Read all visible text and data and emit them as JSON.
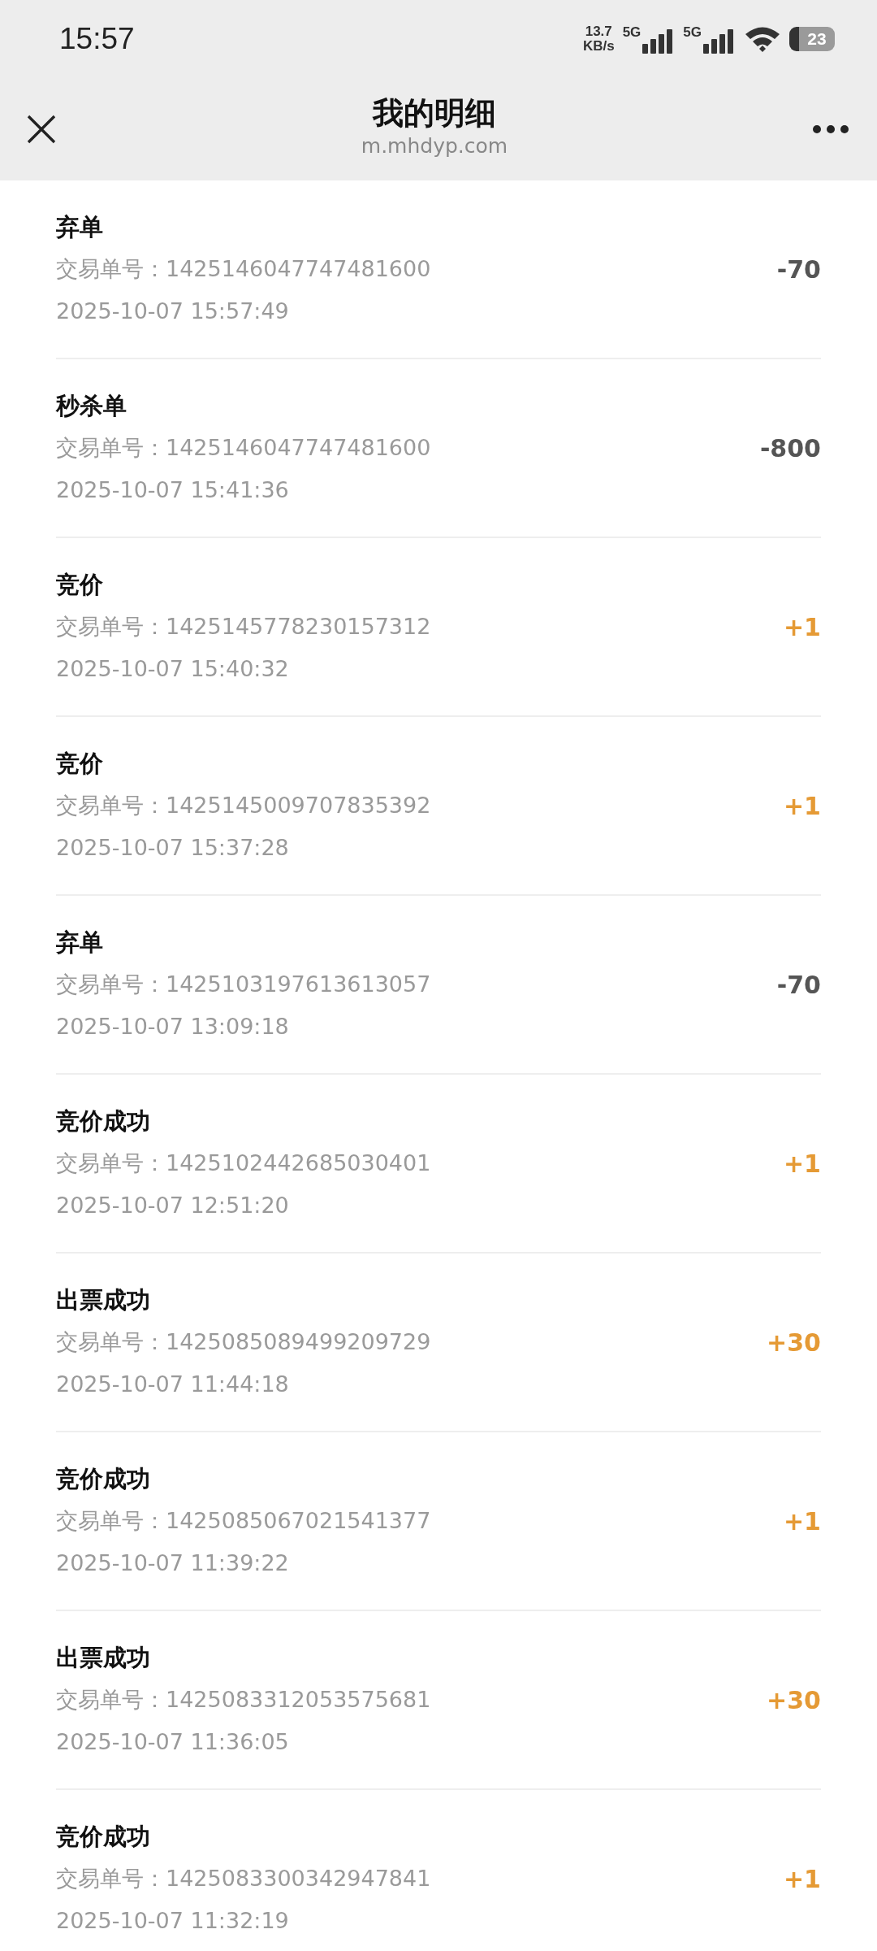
{
  "status_bar": {
    "time": "15:57",
    "net_speed": "13.7",
    "net_unit": "KB/s",
    "sim_labels": [
      "5G",
      "5G"
    ],
    "battery": "23"
  },
  "header": {
    "title": "我的明细",
    "url": "m.mhdyp.com"
  },
  "records": [
    {
      "title": "弃单",
      "order_label": "交易单号：",
      "order_no": "1425146047747481600",
      "time": "2025-10-07 15:57:49",
      "amount": "-70",
      "kind": "debit"
    },
    {
      "title": "秒杀单",
      "order_label": "交易单号：",
      "order_no": "1425146047747481600",
      "time": "2025-10-07 15:41:36",
      "amount": "-800",
      "kind": "debit"
    },
    {
      "title": "竞价",
      "order_label": "交易单号：",
      "order_no": "1425145778230157312",
      "time": "2025-10-07 15:40:32",
      "amount": "+1",
      "kind": "credit"
    },
    {
      "title": "竞价",
      "order_label": "交易单号：",
      "order_no": "1425145009707835392",
      "time": "2025-10-07 15:37:28",
      "amount": "+1",
      "kind": "credit"
    },
    {
      "title": "弃单",
      "order_label": "交易单号：",
      "order_no": "1425103197613613057",
      "time": "2025-10-07 13:09:18",
      "amount": "-70",
      "kind": "debit"
    },
    {
      "title": "竞价成功",
      "order_label": "交易单号：",
      "order_no": "1425102442685030401",
      "time": "2025-10-07 12:51:20",
      "amount": "+1",
      "kind": "credit"
    },
    {
      "title": "出票成功",
      "order_label": "交易单号：",
      "order_no": "1425085089499209729",
      "time": "2025-10-07 11:44:18",
      "amount": "+30",
      "kind": "credit"
    },
    {
      "title": "竞价成功",
      "order_label": "交易单号：",
      "order_no": "1425085067021541377",
      "time": "2025-10-07 11:39:22",
      "amount": "+1",
      "kind": "credit"
    },
    {
      "title": "出票成功",
      "order_label": "交易单号：",
      "order_no": "1425083312053575681",
      "time": "2025-10-07 11:36:05",
      "amount": "+30",
      "kind": "credit"
    },
    {
      "title": "竞价成功",
      "order_label": "交易单号：",
      "order_no": "1425083300342947841",
      "time": "2025-10-07 11:32:19",
      "amount": "+1",
      "kind": "credit"
    }
  ]
}
